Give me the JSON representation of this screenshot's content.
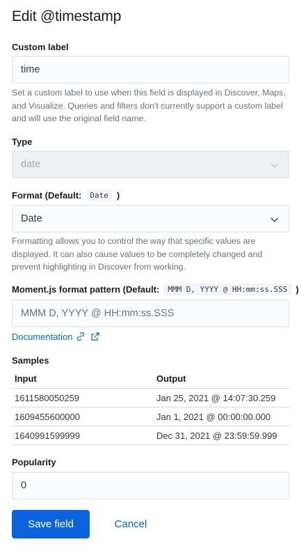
{
  "header": {
    "title": "Edit @timestamp"
  },
  "custom_label": {
    "label": "Custom label",
    "value": "time",
    "help": "Set a custom label to use when this field is displayed in Discover, Maps, and Visualize. Queries and filters don't currently support a custom label and will use the original field name."
  },
  "type": {
    "label": "Type",
    "value": "date",
    "icon": "chevron-down-icon"
  },
  "format": {
    "label_prefix": "Format (Default:",
    "default_code": "Date",
    "label_suffix": ")",
    "value": "Date",
    "help": "Formatting allows you to control the way that specific values are displayed. It can also cause values to be completely changed and prevent highlighting in Discover from working."
  },
  "pattern": {
    "label_prefix": "Moment.js format pattern (Default:",
    "default_code": "MMM D, YYYY @ HH:mm:ss.SSS",
    "label_suffix": ")",
    "placeholder": "MMM D, YYYY @ HH:mm:ss.SSS",
    "doc_link": "Documentation",
    "icons": [
      "link-icon",
      "external-link-icon"
    ]
  },
  "samples": {
    "label": "Samples",
    "columns": [
      "Input",
      "Output"
    ],
    "rows": [
      [
        "1611580050259",
        "Jan 25, 2021 @ 14:07:30.259"
      ],
      [
        "1609455600000",
        "Jan 1, 2021 @ 00:00:00.000"
      ],
      [
        "1640991599999",
        "Dec 31, 2021 @ 23:59:59.999"
      ]
    ]
  },
  "popularity": {
    "label": "Popularity",
    "value": "0"
  },
  "actions": {
    "save": "Save field",
    "cancel": "Cancel"
  },
  "colors": {
    "primary": "#0b64dd",
    "link": "#006bb8"
  }
}
